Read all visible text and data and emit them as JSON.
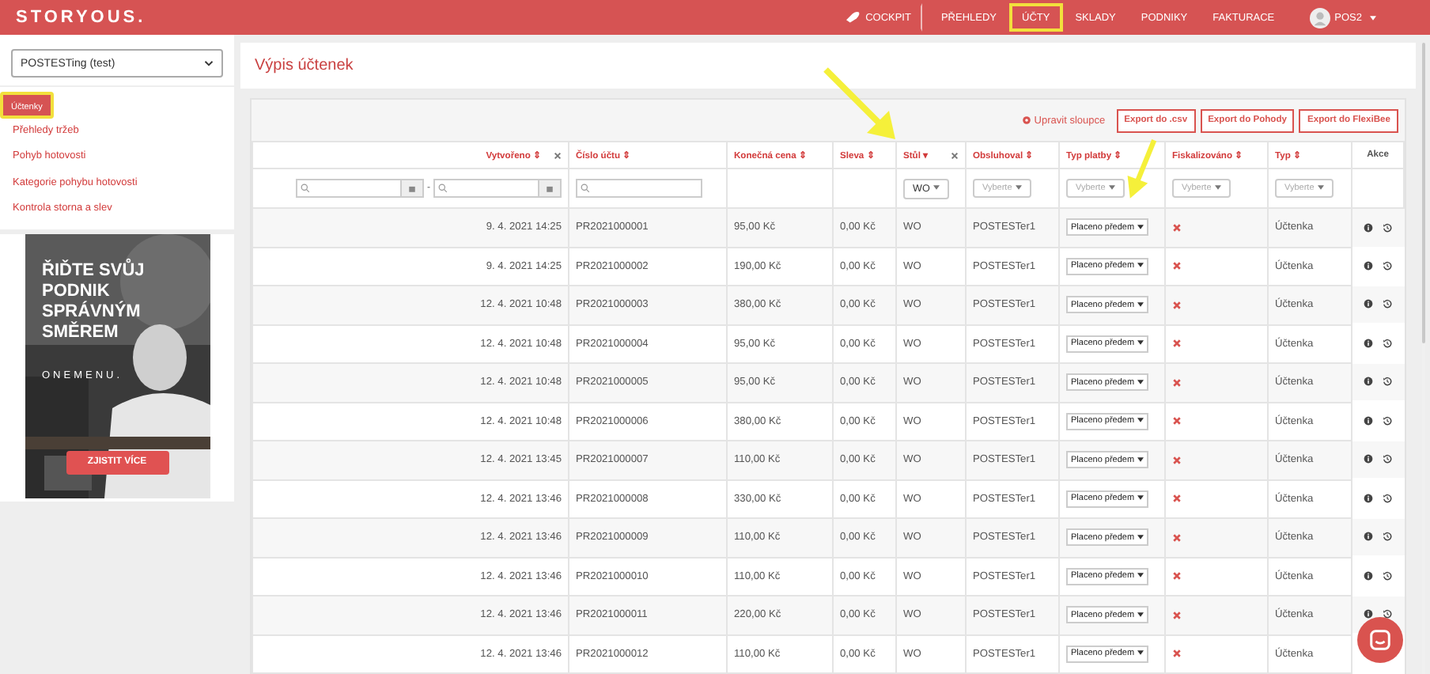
{
  "navbar": {
    "logo": "STORYOUS.",
    "items": [
      {
        "label": "COCKPIT",
        "kind": "icon",
        "highlighted": false
      },
      {
        "label": "PŘEHLEDY",
        "kind": "plain",
        "highlighted": false
      },
      {
        "label": "ÚČTY",
        "kind": "plain",
        "highlighted": true
      },
      {
        "label": "SKLADY",
        "kind": "plain",
        "highlighted": false
      },
      {
        "label": "PODNIKY",
        "kind": "plain",
        "highlighted": false
      },
      {
        "label": "FAKTURACE",
        "kind": "plain",
        "highlighted": false
      }
    ],
    "user": "POS2"
  },
  "sidebar": {
    "place_select": "POSTESTing (test)",
    "items": [
      {
        "label": "Účtenky",
        "selected": true,
        "highlighted": true
      },
      {
        "label": "Přehledy tržeb",
        "selected": false,
        "highlighted": false
      },
      {
        "label": "Pohyb hotovosti",
        "selected": false,
        "highlighted": false
      },
      {
        "label": "Kategorie pohybu hotovosti",
        "selected": false,
        "highlighted": false
      },
      {
        "label": "Kontrola storna a slev",
        "selected": false,
        "highlighted": false
      }
    ],
    "ad": {
      "kind": "picture",
      "headline": [
        "ŘIĎTE SVŮJ",
        "PODNIK",
        "SPRÁVNÝM",
        "SMĚREM"
      ],
      "brand": "ONEMENU.",
      "button": "ZJISTIT VÍCE"
    }
  },
  "page_title": "Výpis účtenek",
  "toolbar": {
    "edit_columns": "Upravit sloupce",
    "exports": [
      "Export do .csv",
      "Export do Pohody",
      "Export do FlexiBee"
    ]
  },
  "table": {
    "columns": [
      {
        "label": "Vytvořeno ⇕",
        "removable": true,
        "filter": {
          "kind": "daterange",
          "separator": "-"
        }
      },
      {
        "label": "Číslo účtu ⇕",
        "removable": false,
        "filter": {
          "kind": "search"
        }
      },
      {
        "label": "Konečná cena ⇕",
        "removable": false
      },
      {
        "label": "Sleva ⇕",
        "removable": false
      },
      {
        "label": "Stůl ▾",
        "removable": true,
        "filter": {
          "kind": "select",
          "value": "WO"
        }
      },
      {
        "label": "Obsluhoval ⇕",
        "removable": false,
        "filter": {
          "kind": "select",
          "placeholder": "Vyberte"
        }
      },
      {
        "label": "Typ platby ⇕",
        "removable": false,
        "filter": {
          "kind": "select",
          "placeholder": "Vyberte"
        }
      },
      {
        "label": "Fiskalizováno ⇕",
        "removable": false,
        "filter": {
          "kind": "select",
          "placeholder": "Vyberte"
        }
      },
      {
        "label": "Typ ⇕",
        "removable": false,
        "filter": {
          "kind": "select",
          "placeholder": "Vyberte"
        }
      },
      {
        "label": "Akce",
        "removable": false
      }
    ],
    "rows": [
      {
        "created": "9. 4. 2021 14:25",
        "number": "PR2021000001",
        "total": "95,00 Kč",
        "discount": "0,00 Kč",
        "table": "WO",
        "waiter": "POSTESTer1",
        "payment": "Placeno předem",
        "fiscalized": false,
        "type": "Účtenka"
      },
      {
        "created": "9. 4. 2021 14:25",
        "number": "PR2021000002",
        "total": "190,00 Kč",
        "discount": "0,00 Kč",
        "table": "WO",
        "waiter": "POSTESTer1",
        "payment": "Placeno předem",
        "fiscalized": false,
        "type": "Účtenka"
      },
      {
        "created": "12. 4. 2021 10:48",
        "number": "PR2021000003",
        "total": "380,00 Kč",
        "discount": "0,00 Kč",
        "table": "WO",
        "waiter": "POSTESTer1",
        "payment": "Placeno předem",
        "fiscalized": false,
        "type": "Účtenka"
      },
      {
        "created": "12. 4. 2021 10:48",
        "number": "PR2021000004",
        "total": "95,00 Kč",
        "discount": "0,00 Kč",
        "table": "WO",
        "waiter": "POSTESTer1",
        "payment": "Placeno předem",
        "fiscalized": false,
        "type": "Účtenka"
      },
      {
        "created": "12. 4. 2021 10:48",
        "number": "PR2021000005",
        "total": "95,00 Kč",
        "discount": "0,00 Kč",
        "table": "WO",
        "waiter": "POSTESTer1",
        "payment": "Placeno předem",
        "fiscalized": false,
        "type": "Účtenka"
      },
      {
        "created": "12. 4. 2021 10:48",
        "number": "PR2021000006",
        "total": "380,00 Kč",
        "discount": "0,00 Kč",
        "table": "WO",
        "waiter": "POSTESTer1",
        "payment": "Placeno předem",
        "fiscalized": false,
        "type": "Účtenka"
      },
      {
        "created": "12. 4. 2021 13:45",
        "number": "PR2021000007",
        "total": "110,00 Kč",
        "discount": "0,00 Kč",
        "table": "WO",
        "waiter": "POSTESTer1",
        "payment": "Placeno předem",
        "fiscalized": false,
        "type": "Účtenka"
      },
      {
        "created": "12. 4. 2021 13:46",
        "number": "PR2021000008",
        "total": "330,00 Kč",
        "discount": "0,00 Kč",
        "table": "WO",
        "waiter": "POSTESTer1",
        "payment": "Placeno předem",
        "fiscalized": false,
        "type": "Účtenka"
      },
      {
        "created": "12. 4. 2021 13:46",
        "number": "PR2021000009",
        "total": "110,00 Kč",
        "discount": "0,00 Kč",
        "table": "WO",
        "waiter": "POSTESTer1",
        "payment": "Placeno předem",
        "fiscalized": false,
        "type": "Účtenka"
      },
      {
        "created": "12. 4. 2021 13:46",
        "number": "PR2021000010",
        "total": "110,00 Kč",
        "discount": "0,00 Kč",
        "table": "WO",
        "waiter": "POSTESTer1",
        "payment": "Placeno předem",
        "fiscalized": false,
        "type": "Účtenka"
      },
      {
        "created": "12. 4. 2021 13:46",
        "number": "PR2021000011",
        "total": "220,00 Kč",
        "discount": "0,00 Kč",
        "table": "WO",
        "waiter": "POSTESTer1",
        "payment": "Placeno předem",
        "fiscalized": false,
        "type": "Účtenka"
      },
      {
        "created": "12. 4. 2021 13:46",
        "number": "PR2021000012",
        "total": "110,00 Kč",
        "discount": "0,00 Kč",
        "table": "WO",
        "waiter": "POSTESTer1",
        "payment": "Placeno předem",
        "fiscalized": false,
        "type": "Účtenka"
      }
    ]
  }
}
